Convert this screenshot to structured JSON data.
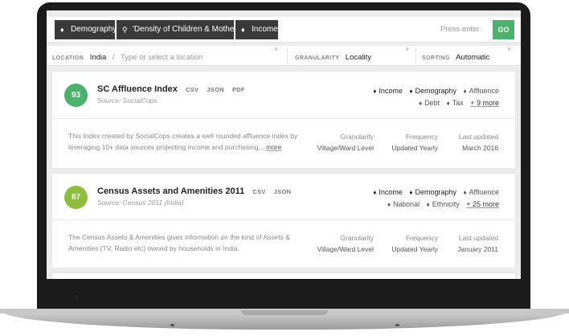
{
  "search": {
    "chips": [
      {
        "icon": "tag-icon",
        "label": "Demography"
      },
      {
        "icon": "search-icon",
        "label": "'Density of Children & Mothers'"
      },
      {
        "icon": "tag-icon",
        "label": "Income"
      }
    ],
    "hint": "Press enter",
    "go_label": "GO"
  },
  "filters": {
    "location_label": "LOCATION",
    "location_value": "India",
    "location_slash": "/",
    "location_placeholder": "Type or select a location",
    "granularity_label": "GRANULARITY",
    "granularity_value": "Locality",
    "sorting_label": "SORTING",
    "sorting_value": "Automatic"
  },
  "colors": {
    "score_1": "#4cb26b",
    "score_2": "#8cbd3f",
    "go": "#4cb26b"
  },
  "results": [
    {
      "score": "93",
      "title": "SC Affluence Index",
      "formats": [
        "CSV",
        "JSON",
        "PDF"
      ],
      "source": "Source: SocialCops",
      "tags_row1": [
        "Income",
        "Demography",
        "Affluence"
      ],
      "tags_row2": [
        "Debt",
        "Tax"
      ],
      "more_tags": "+ 9 more",
      "description": "This Index created by SocialCops creates a well rounded affluence index by leveraging 10+ data sources projecting income and purchasing...",
      "more_link": "more",
      "granularity_label": "Granularity",
      "granularity": "Village/Ward Level",
      "frequency_label": "Frequency",
      "frequency": "Updated Yearly",
      "updated_label": "Last updated",
      "updated": "March 2016"
    },
    {
      "score": "87",
      "title": "Census Assets and Amenities 2011",
      "formats": [
        "CSV",
        "JSON"
      ],
      "source": "Source: Census 2011 (India)",
      "tags_row1": [
        "Income",
        "Demography",
        "Affluence"
      ],
      "tags_row2": [
        "National",
        "Ethnicity"
      ],
      "more_tags": "+ 25 more",
      "description": "The Census Assets & Amenities gives information on the kind of Assets & Amenities (TV, Radio etc) owned by households in India.",
      "granularity_label": "Granularity",
      "granularity": "Village/Ward Level",
      "frequency_label": "Frequency",
      "frequency": "Updated Yearly",
      "updated_label": "Last updated",
      "updated": "January 2011"
    }
  ]
}
